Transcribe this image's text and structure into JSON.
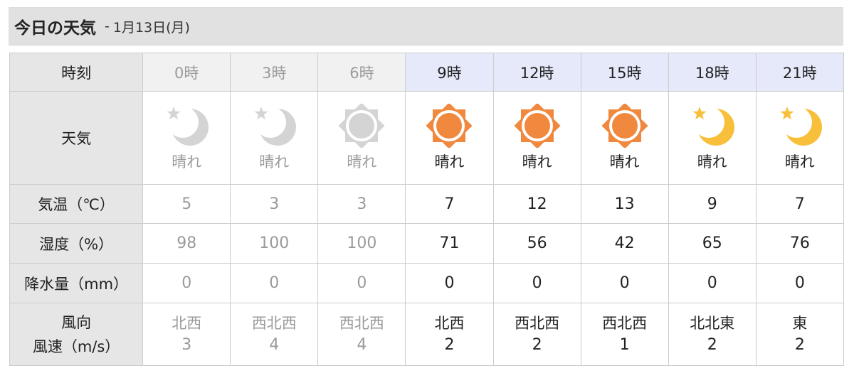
{
  "header": {
    "title": "今日の天気",
    "separator": "-",
    "date": "1月13日(月)"
  },
  "table": {
    "labels": {
      "time": "時刻",
      "weather": "天気",
      "temperature": "気温（℃）",
      "humidity": "湿度（%）",
      "precipitation": "降水量（mm）",
      "wind_direction": "風向",
      "wind_speed": "風速（m/s）"
    },
    "colors": {
      "past_text": "#9a9a9a",
      "future_text": "#222222",
      "header_future_bg": "#e6e9fa",
      "sun_orange": "#f0883e",
      "moon_yellow": "#f7bf3a",
      "past_icon_gray": "#d4d4d4"
    },
    "columns": [
      {
        "time": "0時",
        "icon": "moon-star-icon",
        "weather": "晴れ",
        "temp": "5",
        "humidity": "98",
        "precip": "0",
        "wind_dir": "北西",
        "wind_speed": "3",
        "past": true
      },
      {
        "time": "3時",
        "icon": "moon-star-icon",
        "weather": "晴れ",
        "temp": "3",
        "humidity": "100",
        "precip": "0",
        "wind_dir": "西北西",
        "wind_speed": "4",
        "past": true
      },
      {
        "time": "6時",
        "icon": "sun-icon",
        "weather": "晴れ",
        "temp": "3",
        "humidity": "100",
        "precip": "0",
        "wind_dir": "西北西",
        "wind_speed": "4",
        "past": true
      },
      {
        "time": "9時",
        "icon": "sun-icon",
        "weather": "晴れ",
        "temp": "7",
        "humidity": "71",
        "precip": "0",
        "wind_dir": "北西",
        "wind_speed": "2",
        "past": false
      },
      {
        "time": "12時",
        "icon": "sun-icon",
        "weather": "晴れ",
        "temp": "12",
        "humidity": "56",
        "precip": "0",
        "wind_dir": "西北西",
        "wind_speed": "2",
        "past": false
      },
      {
        "time": "15時",
        "icon": "sun-icon",
        "weather": "晴れ",
        "temp": "13",
        "humidity": "42",
        "precip": "0",
        "wind_dir": "西北西",
        "wind_speed": "1",
        "past": false
      },
      {
        "time": "18時",
        "icon": "moon-star-icon",
        "weather": "晴れ",
        "temp": "9",
        "humidity": "65",
        "precip": "0",
        "wind_dir": "北北東",
        "wind_speed": "2",
        "past": false
      },
      {
        "time": "21時",
        "icon": "moon-star-icon",
        "weather": "晴れ",
        "temp": "7",
        "humidity": "76",
        "precip": "0",
        "wind_dir": "東",
        "wind_speed": "2",
        "past": false
      }
    ]
  }
}
